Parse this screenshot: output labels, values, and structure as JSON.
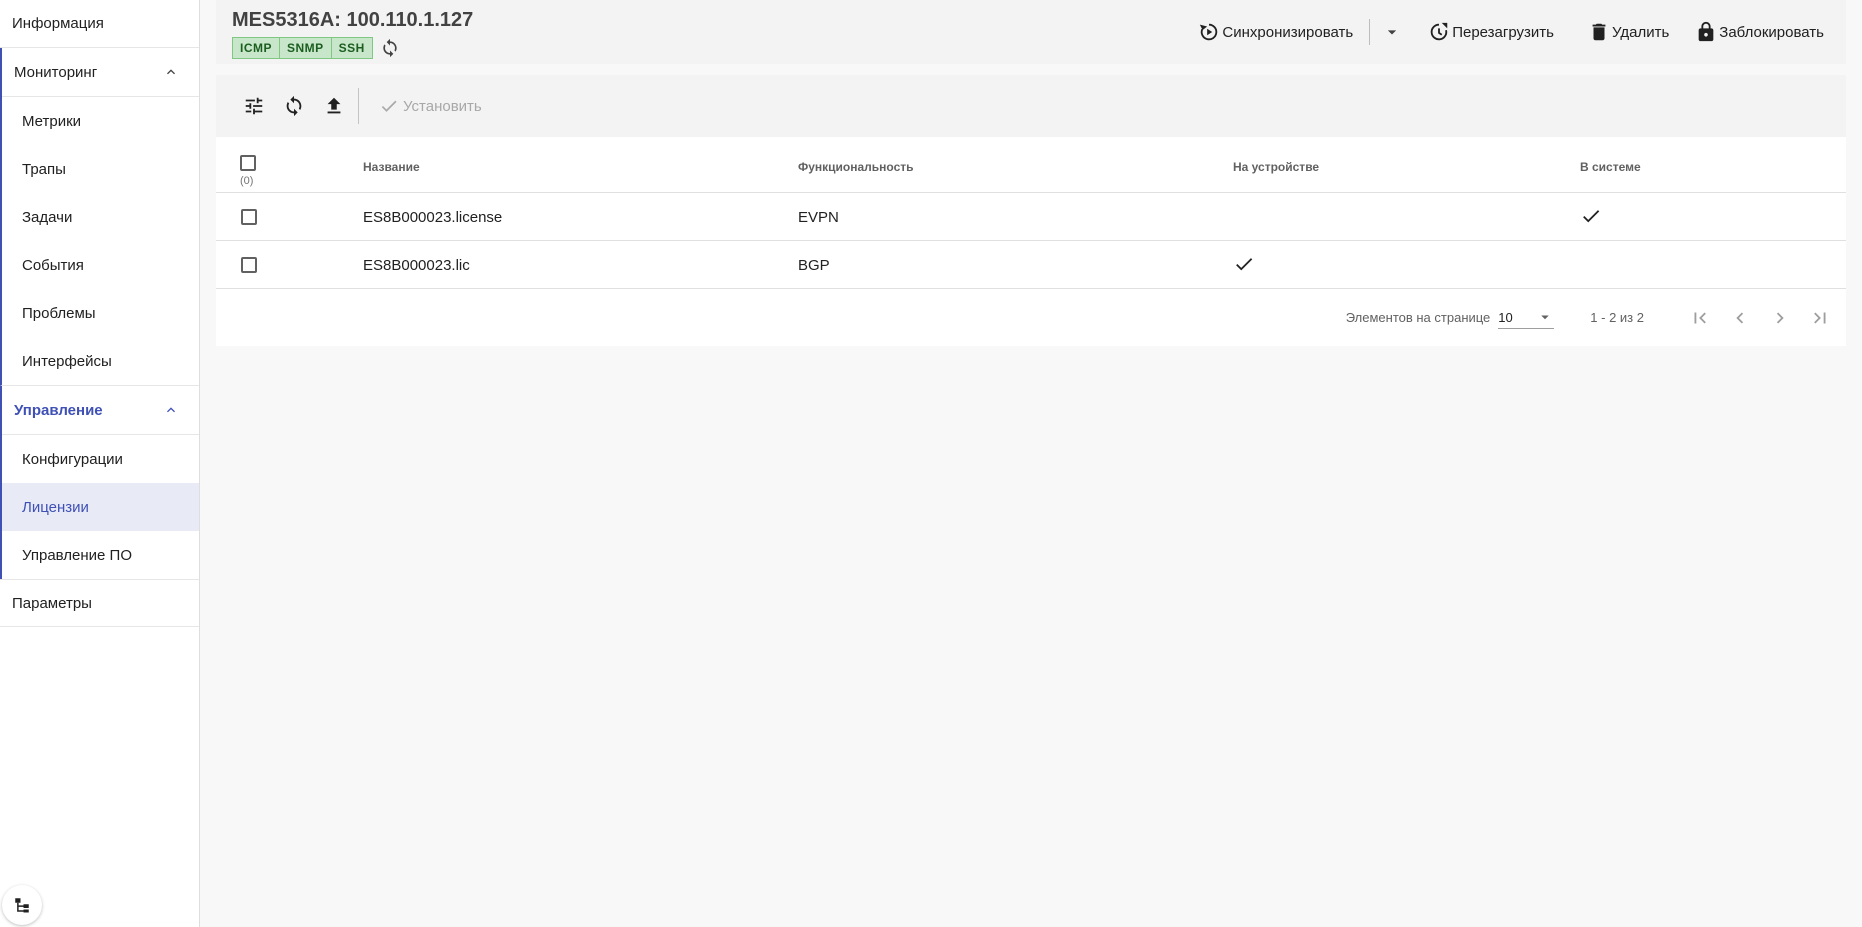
{
  "sidebar": {
    "info": "Информация",
    "monitoring": {
      "label": "Мониторинг",
      "items": [
        "Метрики",
        "Трапы",
        "Задачи",
        "События",
        "Проблемы",
        "Интерфейсы"
      ]
    },
    "management": {
      "label": "Управление",
      "items": [
        "Конфигурации",
        "Лицензии",
        "Управление ПО"
      ],
      "selected": "Лицензии"
    },
    "params": "Параметры"
  },
  "header": {
    "device_title": "MES5316A: 100.110.1.127",
    "badges": [
      "ICMP",
      "SNMP",
      "SSH"
    ],
    "actions": {
      "sync": "Синхронизировать",
      "reboot": "Перезагрузить",
      "delete": "Удалить",
      "lock": "Заблокировать"
    }
  },
  "toolbar": {
    "install": "Установить"
  },
  "table": {
    "select_count": "(0)",
    "columns": [
      "Название",
      "Функциональность",
      "На устройстве",
      "В системе"
    ],
    "rows": [
      {
        "name": "ES8B000023.license",
        "feature": "EVPN",
        "on_device": false,
        "in_system": true
      },
      {
        "name": "ES8B000023.lic",
        "feature": "BGP",
        "on_device": true,
        "in_system": false
      }
    ]
  },
  "paginator": {
    "items_per_page_label": "Элементов на странице",
    "page_size": "10",
    "range": "1 - 2 из 2"
  },
  "colors": {
    "accent": "#3f51b5",
    "badge_bg": "#c8e6c9",
    "badge_border": "#81c784"
  }
}
